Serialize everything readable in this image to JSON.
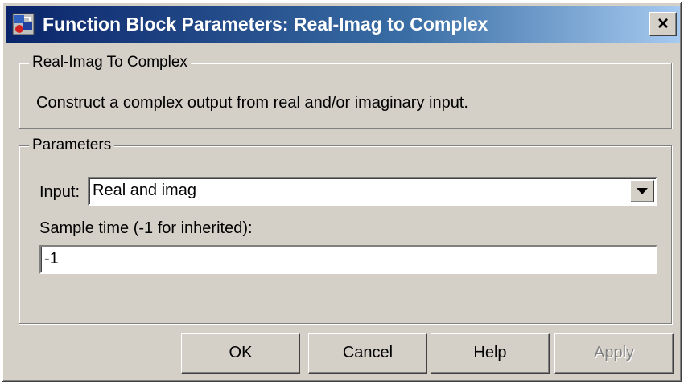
{
  "window": {
    "title": "Function Block Parameters: Real-Imag to Complex",
    "close_glyph": "×",
    "title_icon": "simulink-block-icon"
  },
  "description_group": {
    "legend": "Real-Imag To Complex",
    "text": "Construct a complex output from real and/or imaginary input."
  },
  "parameters_group": {
    "legend": "Parameters",
    "input_label": "Input:",
    "input_value": "Real and imag",
    "sample_time_label": "Sample time (-1 for inherited):",
    "sample_time_value": "-1"
  },
  "buttons": {
    "ok": "OK",
    "cancel": "Cancel",
    "help": "Help",
    "apply": "Apply"
  },
  "colors": {
    "titlebar_start": "#0a246a",
    "titlebar_end": "#a6caf0",
    "dialog_face": "#d4d0c8"
  }
}
